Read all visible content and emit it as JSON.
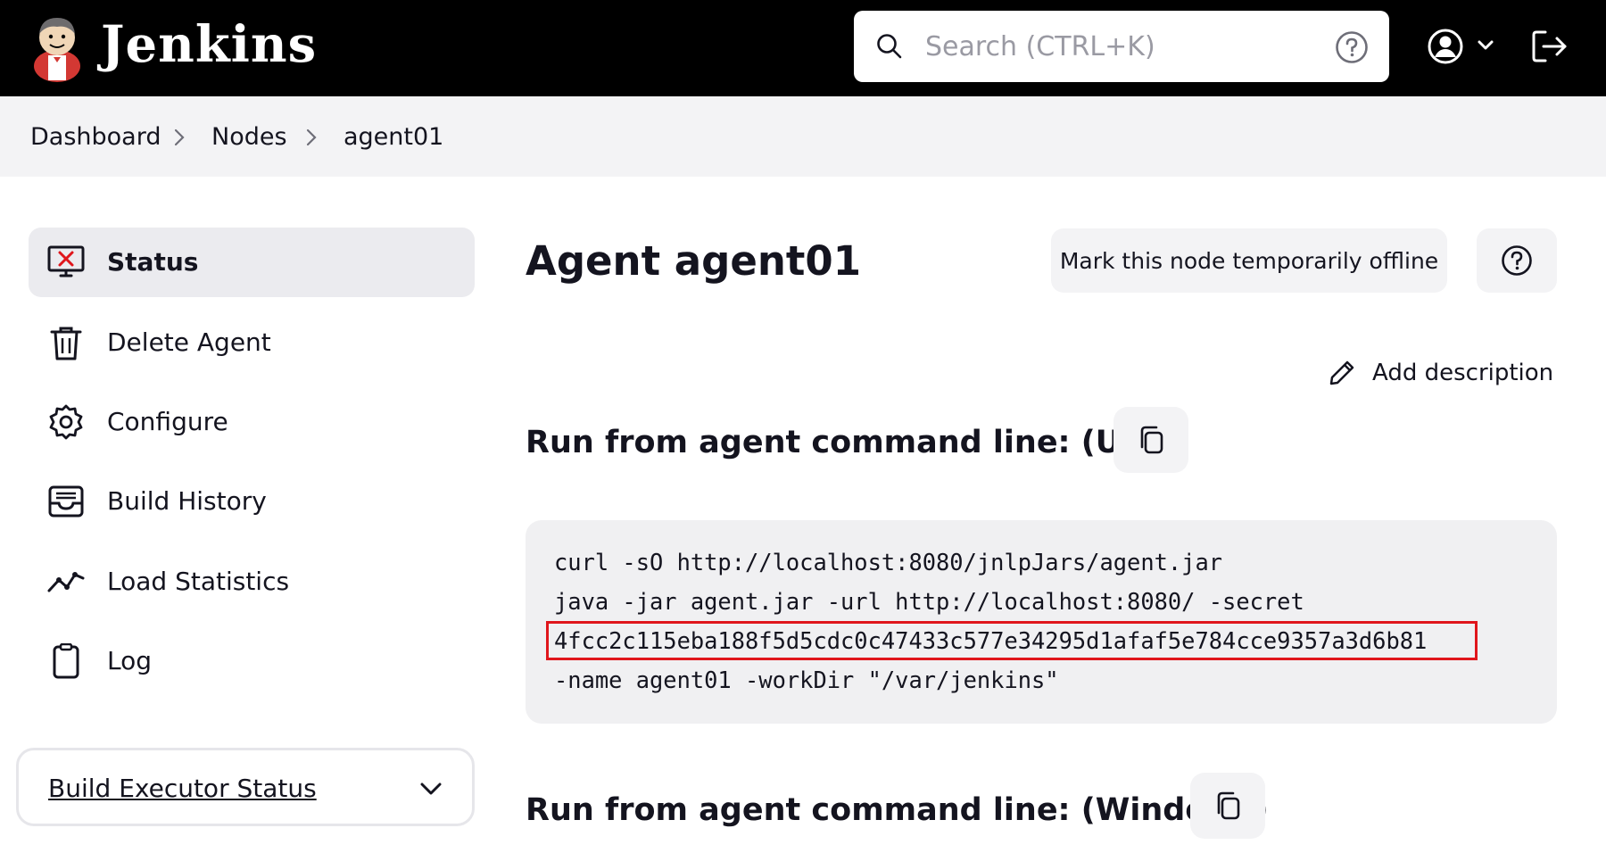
{
  "header": {
    "logo_text": "Jenkins",
    "search_placeholder": "Search (CTRL+K)",
    "icons": [
      "jenkins-logo",
      "search-icon",
      "help-circle-icon",
      "user-icon",
      "chevron-down-icon",
      "logout-icon"
    ]
  },
  "breadcrumb": [
    "Dashboard",
    "Nodes",
    "agent01"
  ],
  "sidebar": {
    "items": [
      {
        "label": "Status",
        "icon": "monitor-x-icon",
        "active": true
      },
      {
        "label": "Delete Agent",
        "icon": "trash-icon"
      },
      {
        "label": "Configure",
        "icon": "gear-icon"
      },
      {
        "label": "Build History",
        "icon": "inbox-icon"
      },
      {
        "label": "Load Statistics",
        "icon": "line-chart-icon"
      },
      {
        "label": "Log",
        "icon": "clipboard-icon"
      }
    ],
    "executor_status": "Build Executor Status"
  },
  "main": {
    "title": "Agent agent01",
    "offline_button": "Mark this node temporarily offline",
    "add_description": "Add description",
    "unix_title": "Run from agent command line: (Unix)",
    "unix_code": [
      "curl -sO http://localhost:8080/jnlpJars/agent.jar",
      "java -jar agent.jar -url http://localhost:8080/ -secret",
      "4fcc2c115eba188f5d5cdc0c47433c577e34295d1afaf5e784cce9357a3d6b81",
      "-name agent01 -workDir \"/var/jenkins\""
    ],
    "windows_title": "Run from agent command line: (Windows)"
  },
  "colors": {
    "header_bg": "#000000",
    "breadcrumb_bg": "#f3f3f5",
    "active_item_bg": "#ebebef",
    "code_bg": "#f0f0f2",
    "highlight_border": "#e0161c"
  }
}
